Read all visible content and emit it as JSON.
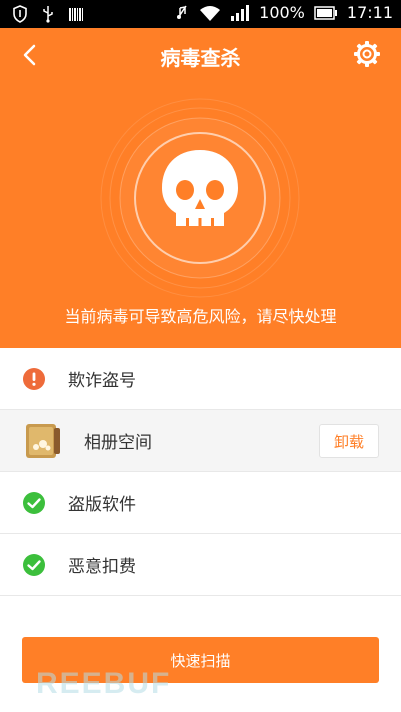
{
  "status_bar": {
    "battery": "100%",
    "time": "17:11",
    "icons": [
      "shield-icon",
      "usb-icon",
      "barcode-icon",
      "mute-icon",
      "wifi-icon",
      "signal-icon",
      "battery-icon"
    ]
  },
  "header": {
    "title": "病毒查杀",
    "back_icon": "back-chevron-icon",
    "settings_icon": "gear-icon",
    "warning_text": "当前病毒可导致高危风险，请尽快处理",
    "center_icon": "skull-icon"
  },
  "items": [
    {
      "label": "欺诈盗号",
      "icon": "warning-circle-icon",
      "status_color": "#ee6b3a"
    },
    {
      "label": "相册空间",
      "icon": "app-icon",
      "action": "卸载"
    },
    {
      "label": "盗版软件",
      "icon": "check-circle-icon",
      "status_color": "#3cbf3c"
    },
    {
      "label": "恶意扣费",
      "icon": "check-circle-icon",
      "status_color": "#3cbf3c"
    }
  ],
  "scan_button": "快速扫描",
  "watermark": "REEBUF",
  "colors": {
    "accent": "#ff7f27",
    "danger": "#ee6b3a",
    "safe": "#3cbf3c"
  }
}
